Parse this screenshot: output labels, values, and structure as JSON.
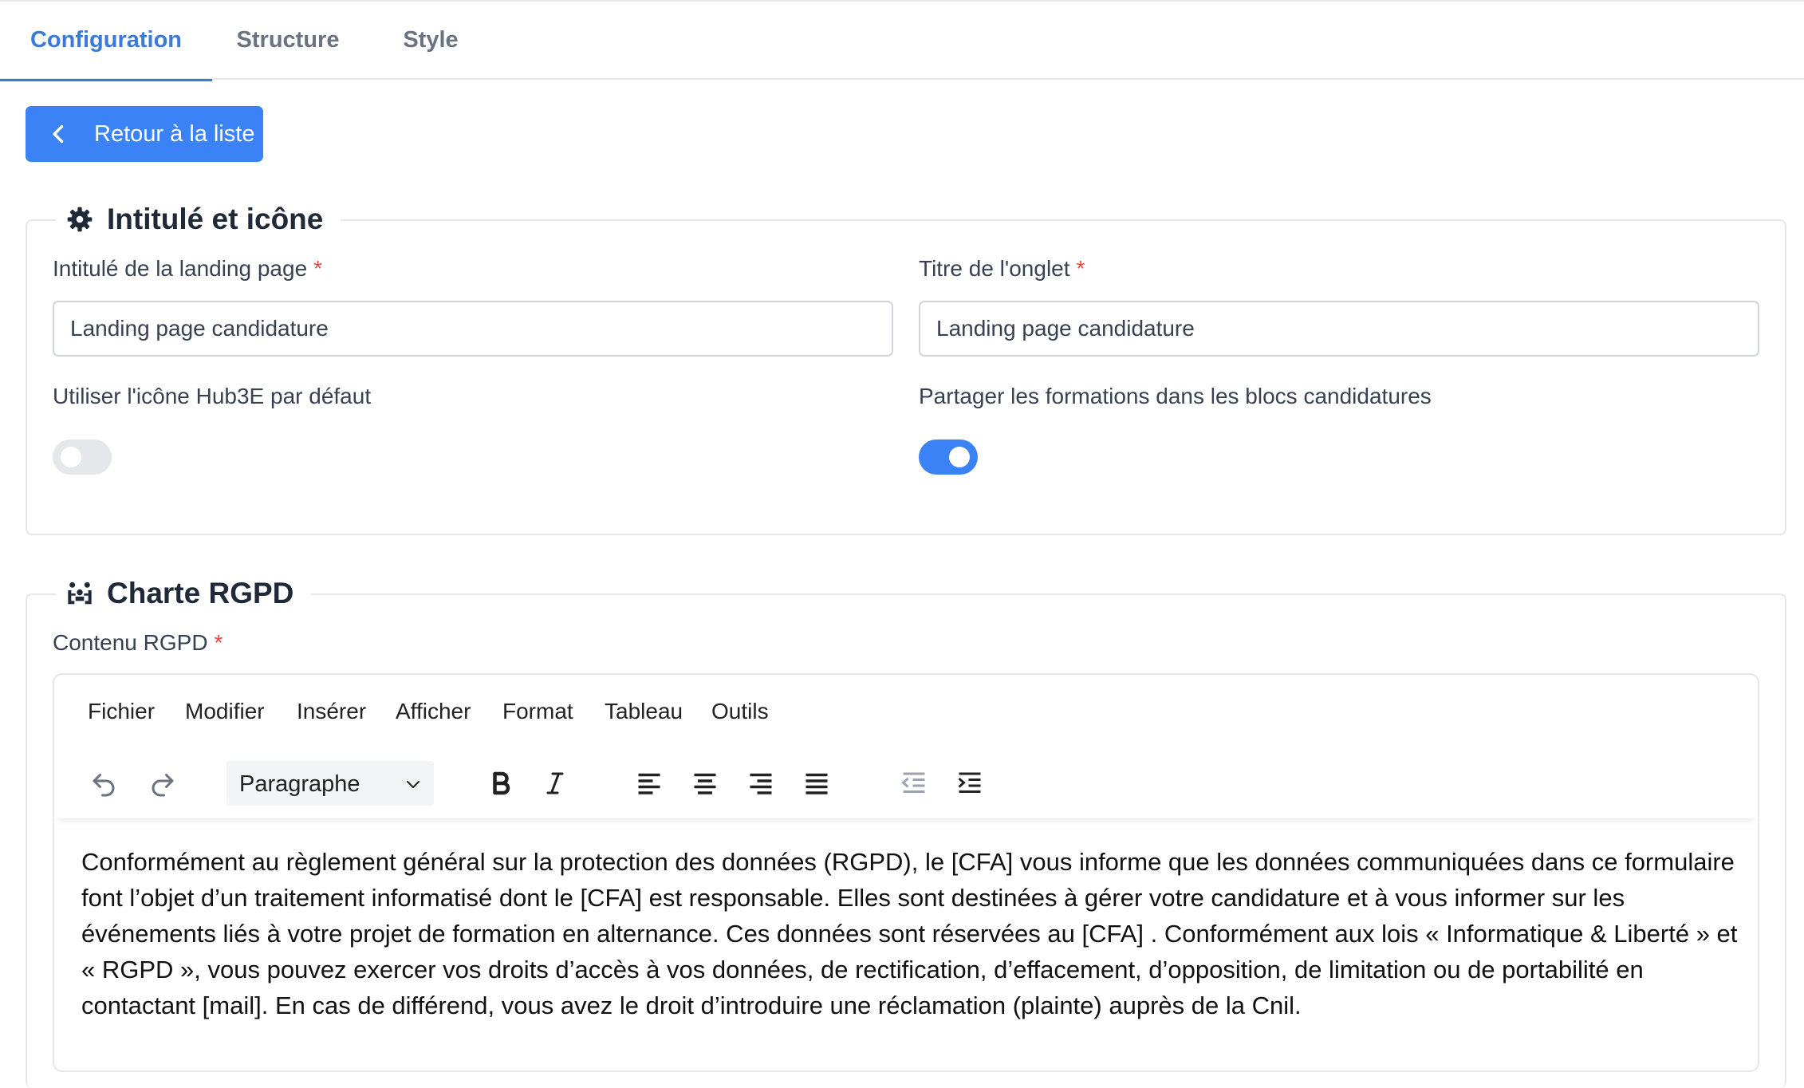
{
  "tabs": [
    {
      "label": "Configuration",
      "active": true
    },
    {
      "label": "Structure",
      "active": false
    },
    {
      "label": "Style",
      "active": false
    }
  ],
  "back_button": {
    "label": "Retour à la liste",
    "icon": "chevron-left-icon"
  },
  "section_title": {
    "legend": "Intitulé et icône",
    "icon": "gear-icon",
    "landing_label": "Intitulé de la landing page",
    "landing_value": "Landing page candidature",
    "tab_title_label": "Titre de l'onglet",
    "tab_title_value": "Landing page candidature",
    "required_mark": "*",
    "default_icon_label": "Utiliser l'icône Hub3E par défaut",
    "default_icon_enabled": false,
    "share_label": "Partager les formations dans les blocs candidatures",
    "share_enabled": true
  },
  "section_rgpd": {
    "legend": "Charte RGPD",
    "icon": "users-icon",
    "content_label": "Contenu RGPD",
    "required_mark": "*"
  },
  "editor": {
    "menu": [
      "Fichier",
      "Modifier",
      "Insérer",
      "Afficher",
      "Format",
      "Tableau",
      "Outils"
    ],
    "block_format": "Paragraphe",
    "content": "Conformément au règlement général sur la protection des données (RGPD), le [CFA] vous informe que les données communiquées dans ce formulaire font l’objet d’un traitement informatisé dont le [CFA] est responsable. Elles sont destinées à gérer votre candidature et à vous informer sur les événements liés à votre projet de formation en alternance. Ces données sont réservées au [CFA] . Conformément aux lois « Informatique & Liberté » et « RGPD », vous pouvez exercer vos droits d’accès à vos données, de rectification, d’effacement, d’opposition, de limitation ou de portabilité en contactant [mail]. En cas de différend, vous avez le droit d’introduire une réclamation (plainte) auprès de la Cnil."
  },
  "colors": {
    "accent": "#3b82f6",
    "tab_active": "#3b7ad9",
    "required": "#ef4444"
  }
}
